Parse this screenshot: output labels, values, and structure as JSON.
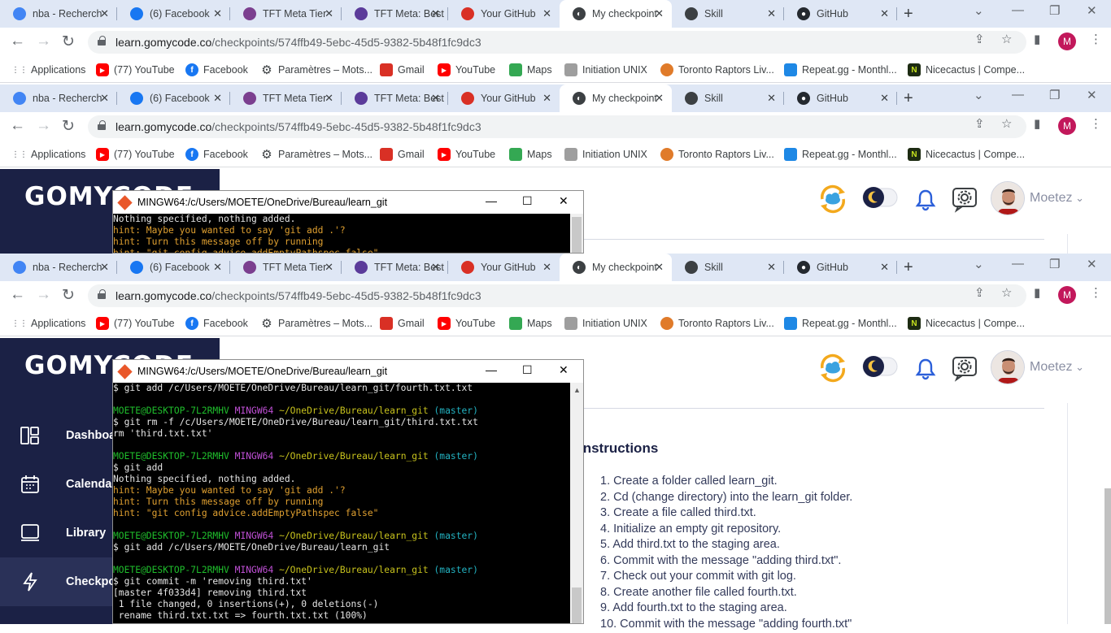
{
  "tabs": [
    {
      "label": "nba - Recherche",
      "favicon": "google-icon",
      "color": "#4285f4"
    },
    {
      "label": "(6) Facebook",
      "favicon": "facebook-icon",
      "color": "#1877f2"
    },
    {
      "label": "TFT Meta Tier",
      "favicon": "tft-icon",
      "color": "#7b3f8f"
    },
    {
      "label": "TFT Meta: Best",
      "favicon": "tft-meta-icon",
      "color": "#5b3b9a"
    },
    {
      "label": "Your GitHub",
      "favicon": "gmail-rocket-icon",
      "color": "#d93025"
    },
    {
      "label": "My checkpoint",
      "favicon": "chrome-icon",
      "color": "#3c4043"
    },
    {
      "label": "Skill",
      "favicon": "skill-icon",
      "color": "#3c4043"
    },
    {
      "label": "GitHub",
      "favicon": "github-icon",
      "color": "#24292f"
    }
  ],
  "address": {
    "host": "learn.gomycode.co",
    "path": "/checkpoints/574ffb49-5ebc-45d5-9382-5b48f1fc9dc3"
  },
  "profile_initial": "M",
  "bookmarks": [
    {
      "label": "Applications",
      "icon": "apps-grid-icon",
      "color": "#5f6368"
    },
    {
      "label": "(77) YouTube",
      "icon": "youtube-icon",
      "color": "#ff0000"
    },
    {
      "label": "Facebook",
      "icon": "facebook-icon",
      "color": "#1877f2"
    },
    {
      "label": "Paramètres – Mots...",
      "icon": "gear-icon",
      "color": "#5f6368"
    },
    {
      "label": "Gmail",
      "icon": "gmail-icon",
      "color": "#d93025"
    },
    {
      "label": "YouTube",
      "icon": "youtube-icon",
      "color": "#ff0000"
    },
    {
      "label": "Maps",
      "icon": "maps-icon",
      "color": "#34a853"
    },
    {
      "label": "Initiation UNIX",
      "icon": "unix-icon",
      "color": "#9e9e9e"
    },
    {
      "label": "Toronto Raptors Liv...",
      "icon": "basketball-icon",
      "color": "#e07b2a"
    },
    {
      "label": "Repeat.gg - Monthl...",
      "icon": "repeat-icon",
      "color": "#1e88e5"
    },
    {
      "label": "Nicecactus | Compe...",
      "icon": "nicecactus-icon",
      "color": "#c6e21f"
    }
  ],
  "brand": {
    "logo_text": "GOMYCODE"
  },
  "sidebar": {
    "items": [
      {
        "label": "Dashboard",
        "icon": "dashboard-icon"
      },
      {
        "label": "Calendar",
        "icon": "calendar-icon"
      },
      {
        "label": "Library",
        "icon": "library-icon"
      },
      {
        "label": "Checkpoints",
        "icon": "lightning-icon"
      }
    ]
  },
  "user": {
    "name": "Moetez"
  },
  "terminal": {
    "title": "MINGW64:/c/Users/MOETE/OneDrive/Bureau/learn_git",
    "short_lines": [
      {
        "t": "Nothing specified, nothing added.",
        "c": ""
      },
      {
        "t": "hint: Maybe you wanted to say 'git add .'?",
        "c": "c-orange"
      },
      {
        "t": "hint: Turn this message off by running",
        "c": "c-orange"
      },
      {
        "t": "hint: \"git config advice.addEmptyPathspec false\"",
        "c": "c-orange"
      }
    ],
    "lines": [
      {
        "t": "$ git add /c/Users/MOETE/OneDrive/Bureau/learn_git/fourth.txt.txt",
        "c": ""
      },
      {
        "t": "",
        "c": ""
      },
      {
        "prompt": true,
        "user": "MOETE@DESKTOP-7L2RMHV",
        "sys": "MINGW64",
        "path": "~/OneDrive/Bureau/learn_git",
        "branch": "(master)"
      },
      {
        "t": "$ git rm -f /c/Users/MOETE/OneDrive/Bureau/learn_git/third.txt.txt",
        "c": ""
      },
      {
        "t": "rm 'third.txt.txt'",
        "c": ""
      },
      {
        "t": "",
        "c": ""
      },
      {
        "prompt": true,
        "user": "MOETE@DESKTOP-7L2RMHV",
        "sys": "MINGW64",
        "path": "~/OneDrive/Bureau/learn_git",
        "branch": "(master)"
      },
      {
        "t": "$ git add",
        "c": ""
      },
      {
        "t": "Nothing specified, nothing added.",
        "c": ""
      },
      {
        "t": "hint: Maybe you wanted to say 'git add .'?",
        "c": "c-orange"
      },
      {
        "t": "hint: Turn this message off by running",
        "c": "c-orange"
      },
      {
        "t": "hint: \"git config advice.addEmptyPathspec false\"",
        "c": "c-orange"
      },
      {
        "t": "",
        "c": ""
      },
      {
        "prompt": true,
        "user": "MOETE@DESKTOP-7L2RMHV",
        "sys": "MINGW64",
        "path": "~/OneDrive/Bureau/learn_git",
        "branch": "(master)"
      },
      {
        "t": "$ git add /c/Users/MOETE/OneDrive/Bureau/learn_git",
        "c": ""
      },
      {
        "t": "",
        "c": ""
      },
      {
        "prompt": true,
        "user": "MOETE@DESKTOP-7L2RMHV",
        "sys": "MINGW64",
        "path": "~/OneDrive/Bureau/learn_git",
        "branch": "(master)"
      },
      {
        "t": "$ git commit -m 'removing third.txt'",
        "c": ""
      },
      {
        "t": "[master 4f033d4] removing third.txt",
        "c": ""
      },
      {
        "t": " 1 file changed, 0 insertions(+), 0 deletions(-)",
        "c": ""
      },
      {
        "t": " rename third.txt.txt => fourth.txt.txt (100%)",
        "c": ""
      }
    ]
  },
  "instructions": {
    "title": "Instructions",
    "steps": [
      "1. Create a folder called learn_git.",
      "2. Cd (change directory) into the learn_git folder.",
      "3. Create a file called third.txt.",
      "4. Initialize an empty git repository.",
      "5. Add third.txt to the staging area.",
      "6. Commit with the message \"adding third.txt\".",
      "7. Check out your commit with git log.",
      "8. Create another file called fourth.txt.",
      "9. Add fourth.txt to the staging area.",
      "10. Commit with the message \"adding fourth.txt\""
    ]
  }
}
